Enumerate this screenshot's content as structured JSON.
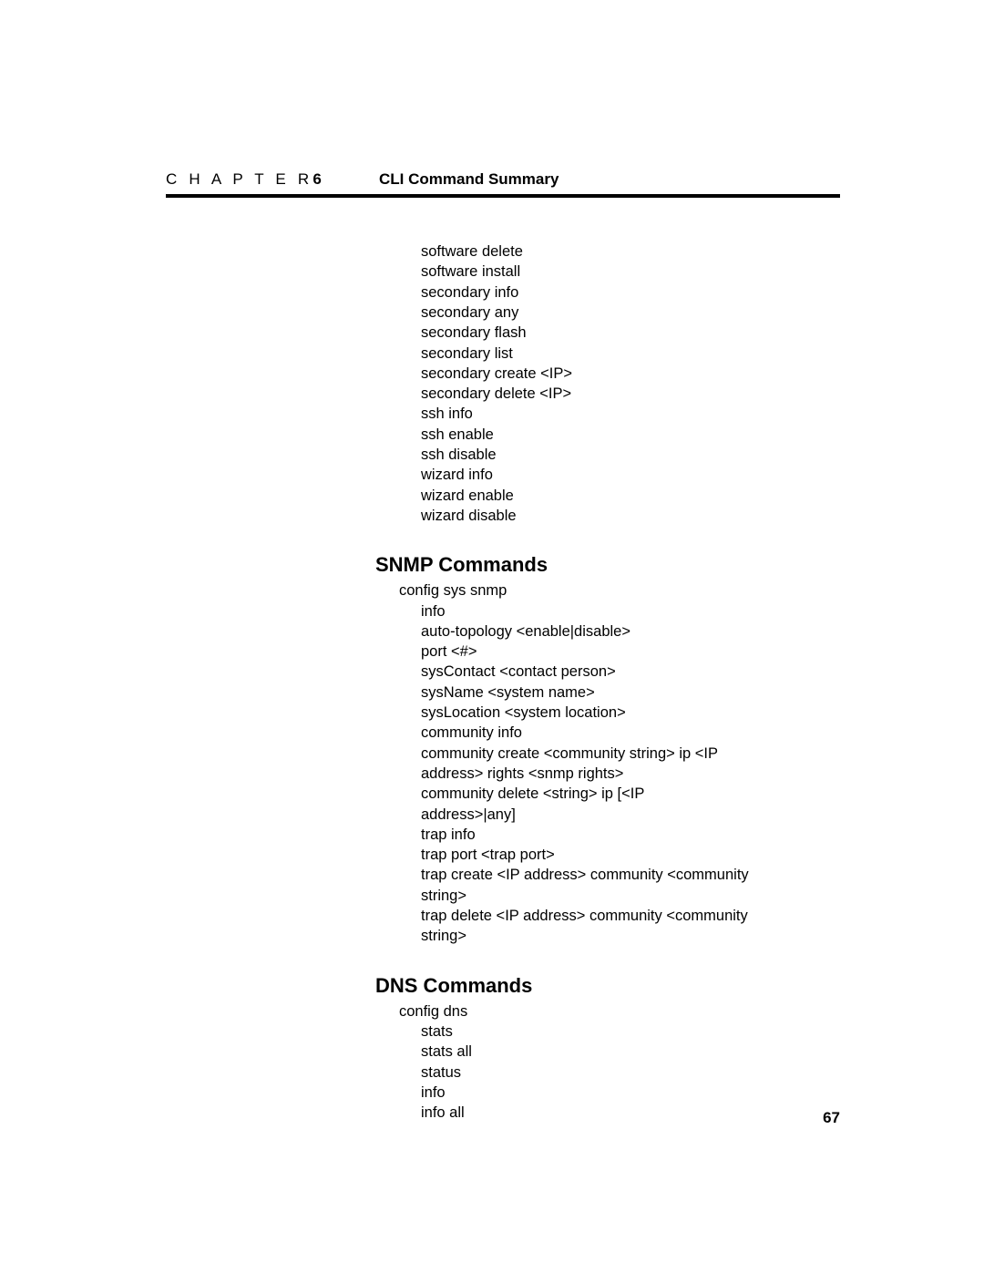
{
  "header": {
    "chapter_word": "C H A P T E R",
    "chapter_number": "6",
    "title": "CLI Command Summary"
  },
  "footer": {
    "page_number": "67"
  },
  "body": {
    "intro_list": [
      "software delete",
      "software install",
      "secondary info",
      "secondary any",
      "secondary flash",
      "secondary list",
      "secondary create <IP>",
      "secondary delete <IP>",
      "ssh info",
      "ssh enable",
      "ssh disable",
      "wizard info",
      "wizard enable",
      "wizard disable"
    ],
    "sections": [
      {
        "heading": "SNMP Commands",
        "root": "config sys snmp",
        "items": [
          "info",
          "auto-topology <enable|disable>",
          "port <#>",
          "sysContact <contact person>",
          "sysName <system name>",
          "sysLocation <system location>",
          "community info",
          "community create <community string> ip <IP",
          "address> rights <snmp rights>",
          "community delete <string> ip [<IP",
          "address>|any]",
          "trap info",
          "trap port <trap port>",
          "trap create <IP address> community <community",
          "string>",
          "trap delete <IP address> community <community",
          "string>"
        ]
      },
      {
        "heading": "DNS Commands",
        "root": "config dns",
        "items": [
          "stats",
          "stats all",
          "status",
          "info",
          "info all"
        ]
      }
    ]
  }
}
